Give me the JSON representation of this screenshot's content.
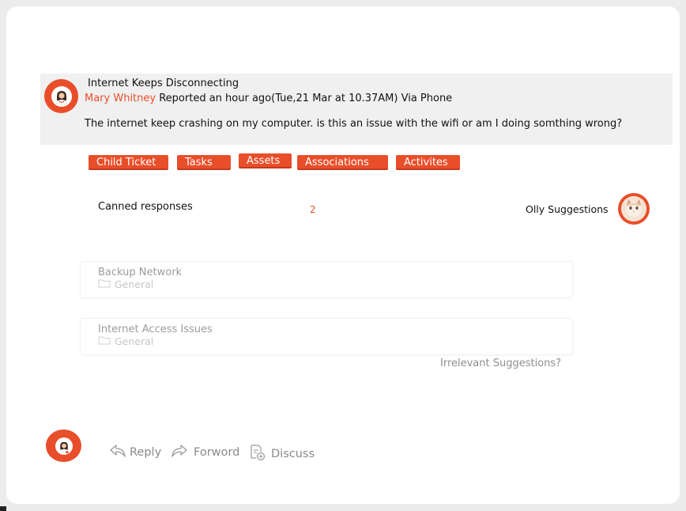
{
  "ticket": {
    "title": "Internet Keeps Disconnecting",
    "reporter_name": "Mary Whitney",
    "reported_text": "Reported an hour ago(Tue,21 Mar at 10.37AM) Via Phone",
    "message": "The internet keep crashing on my computer. is this an issue with the wifi or am I doing somthing wrong?"
  },
  "tabs": [
    "Child Ticket",
    "Tasks",
    "Assets",
    "Associations",
    "Activites"
  ],
  "canned": {
    "label": "Canned responses",
    "count": "2",
    "olly_label": "Olly Suggestions"
  },
  "suggestions": [
    {
      "title": "Backup Network",
      "category": "General"
    },
    {
      "title": "Internet Access Issues",
      "category": "General"
    }
  ],
  "irrelevant_label": "Irrelevant Suggestions?",
  "actions": {
    "reply": "Reply",
    "forward": "Forword",
    "discuss": "Discuss"
  },
  "colors": {
    "accent": "#e94e2a",
    "muted_text": "#8a8a8a"
  }
}
